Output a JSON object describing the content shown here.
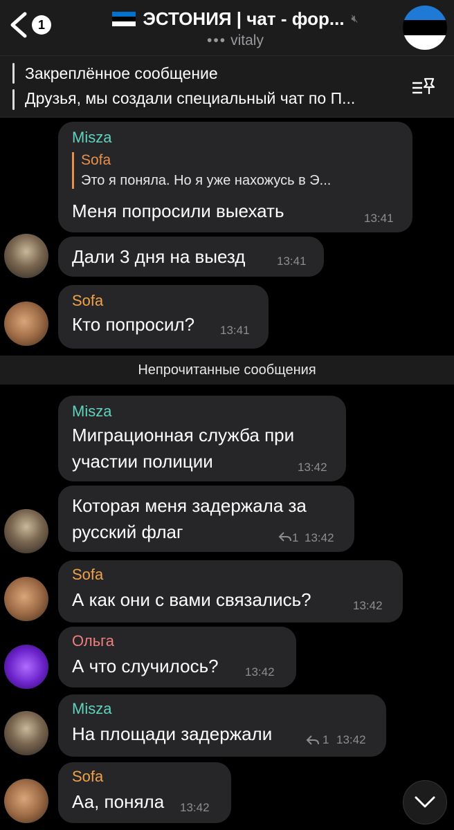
{
  "header": {
    "badge": "1",
    "title": "ЭСТОНИЯ | чат - фор...",
    "subtitle_user": "vitaly",
    "flag_colors": [
      "#0072ce",
      "#000000",
      "#ffffff"
    ]
  },
  "pinned": {
    "title": "Закреплённое сообщение",
    "text": "Друзья, мы создали специальный чат по П..."
  },
  "messages": [
    {
      "sender": "Misza",
      "reply_name": "Sofa",
      "reply_text": "Это я поняла. Но я уже нахожусь в Э...",
      "text": "Меня попросили выехать",
      "time": "13:41"
    },
    {
      "text": "Дали 3 дня на выезд",
      "time": "13:41"
    },
    {
      "sender": "Sofa",
      "text": "Кто попросил?",
      "time": "13:41"
    },
    {
      "sender": "Misza",
      "lines": [
        "Миграционная служба при",
        "участии полиции"
      ],
      "time": "13:42"
    },
    {
      "lines": [
        "Которая меня задержала за",
        "русский флаг"
      ],
      "replies": "1",
      "time": "13:42"
    },
    {
      "sender": "Sofa",
      "text": "А как они с вами связались?",
      "time": "13:42"
    },
    {
      "sender": "Ольга",
      "text": "А что случилось?",
      "time": "13:42"
    },
    {
      "sender": "Misza",
      "text": "На площади задержали",
      "replies": "1",
      "time": "13:42"
    },
    {
      "sender": "Sofa",
      "text": "Аа, поняла",
      "time": "13:42"
    }
  ],
  "unread_divider": "Непрочитанные сообщения",
  "colors": {
    "misza": "#5fd3bc",
    "sofa": "#f0a24a",
    "olga": "#ef7f7f",
    "bubble": "#262628"
  }
}
